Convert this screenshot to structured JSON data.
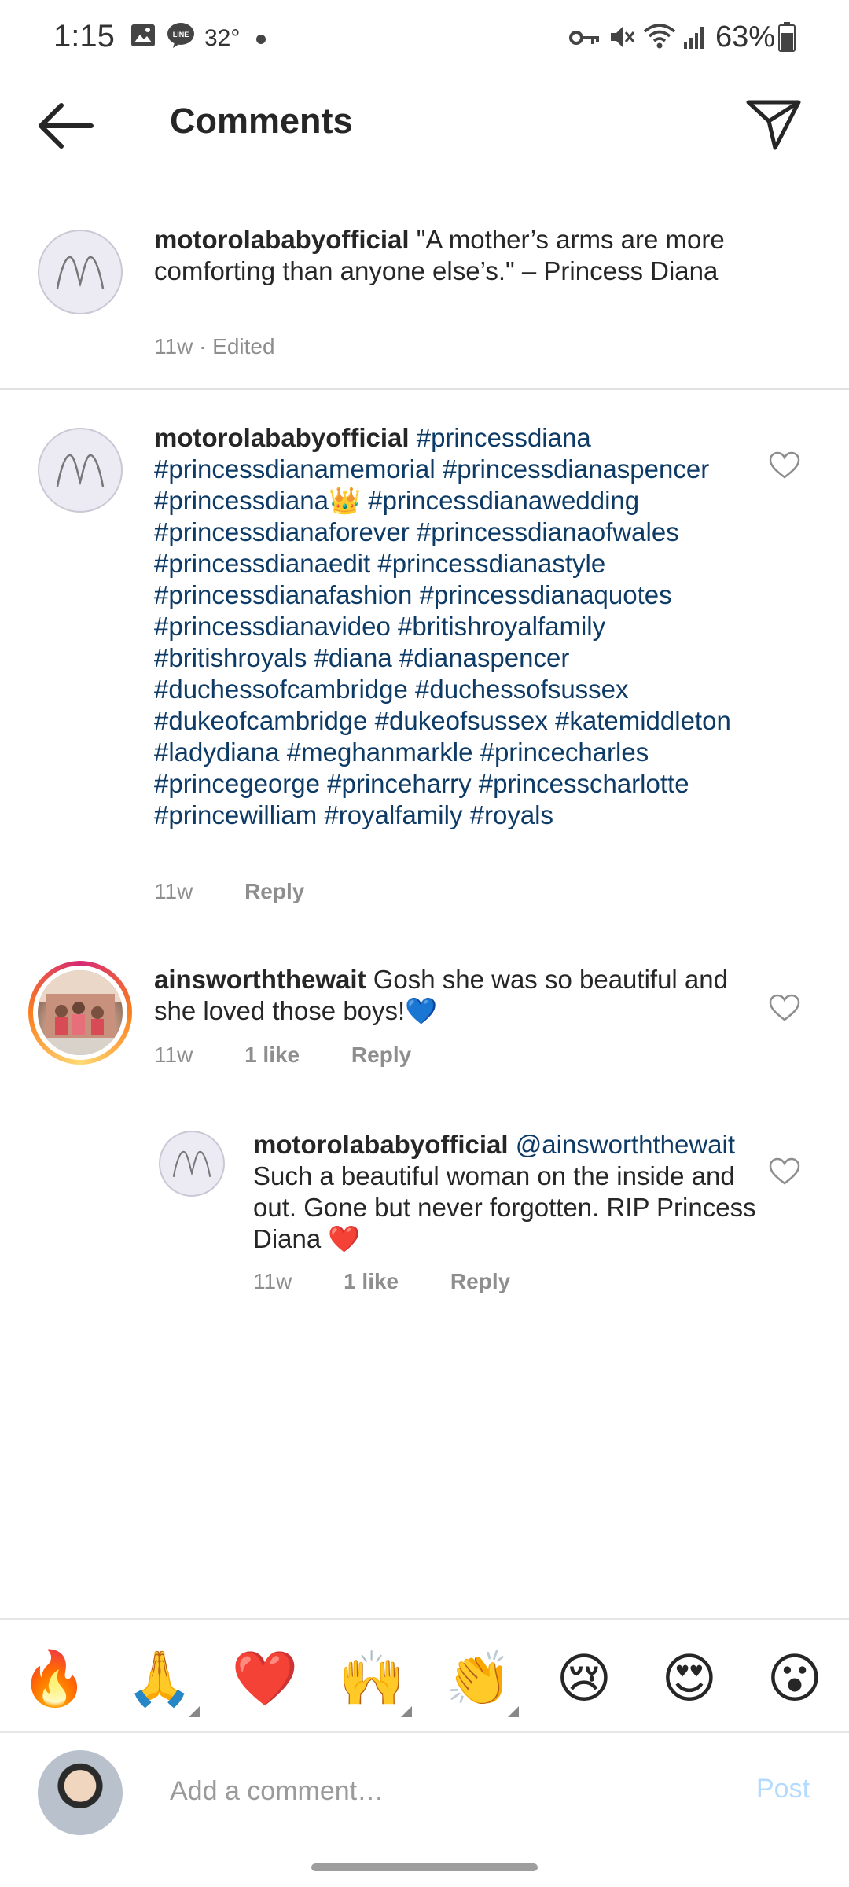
{
  "status_bar": {
    "time": "1:15",
    "temperature": "32°",
    "battery": "63%",
    "icons": [
      "gallery-icon",
      "line-icon",
      "key-icon",
      "mute-icon",
      "wifi-icon",
      "signal-icon",
      "battery-icon"
    ]
  },
  "header": {
    "title": "Comments"
  },
  "caption": {
    "username": "motorolababyofficial",
    "text": "\"A mother’s arms are more comforting than anyone else’s.\" – Princess Diana",
    "meta": "11w · Edited"
  },
  "comments": [
    {
      "username": "motorolababyofficial",
      "text": "#princessdiana #princessdianamemorial #princessdianaspencer #princessdiana👑 #princessdianawedding #princessdianaforever #princessdianaofwales #princessdianaedit #princessdianastyle #princessdianafashion #princessdianaquotes #princessdianavideo #britishroyalfamily #britishroyals #diana #dianaspencer #duchessofcambridge #duchessofsussex #dukeofcambridge #dukeofsussex #katemiddleton #ladydiana #meghanmarkle #princecharles #princegeorge #princeharry #princesscharlotte #princewilliam #royalfamily #royals",
      "time": "11w",
      "reply_label": "Reply"
    },
    {
      "username": "ainsworththewait",
      "text": "Gosh she was so beautiful and she loved those boys!💙",
      "time": "11w",
      "likes": "1 like",
      "reply_label": "Reply"
    }
  ],
  "reply": {
    "username": "motorolababyofficial",
    "mention": "@ainsworththewait",
    "text": "Such a beautiful woman on the inside and out. Gone but never forgotten. RIP Princess Diana ❤️",
    "time": "11w",
    "likes": "1 like",
    "reply_label": "Reply"
  },
  "emoji_bar": [
    "🔥",
    "🙏",
    "❤️",
    "🙌",
    "👏",
    "😢",
    "😍",
    "😮"
  ],
  "compose": {
    "placeholder": "Add a comment…",
    "post_label": "Post"
  },
  "colors": {
    "hashtag": "#0d3b66",
    "meta": "#8e8e8e",
    "post_disabled": "#b3dbff"
  }
}
